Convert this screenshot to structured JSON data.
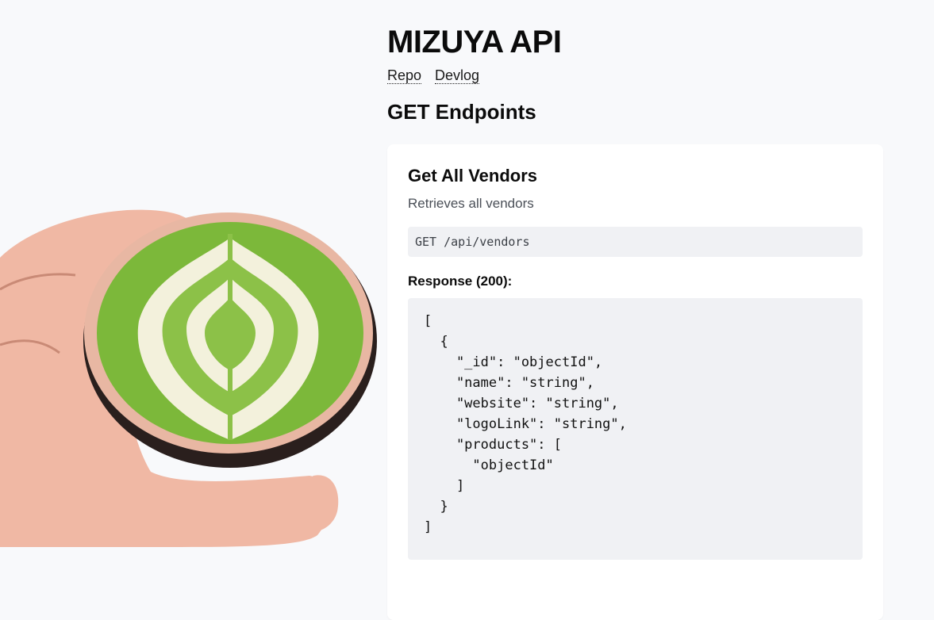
{
  "header": {
    "title": "MIZUYA API",
    "nav": [
      {
        "label": "Repo"
      },
      {
        "label": "Devlog"
      }
    ]
  },
  "section": {
    "title": "GET Endpoints"
  },
  "endpoints": [
    {
      "title": "Get All Vendors",
      "description": "Retrieves all vendors",
      "request": "GET /api/vendors",
      "response_label": "Response (200):",
      "response_body": "[\n  {\n    \"_id\": \"objectId\",\n    \"name\": \"string\",\n    \"website\": \"string\",\n    \"logoLink\": \"string\",\n    \"products\": [\n      \"objectId\"\n    ]\n  }\n]"
    }
  ],
  "colors": {
    "background": "#f8f9fb",
    "card": "#ffffff",
    "code_background": "#f0f1f4",
    "matcha": "#7cb83a"
  },
  "illustration": "matcha-latte-cup-in-hand"
}
